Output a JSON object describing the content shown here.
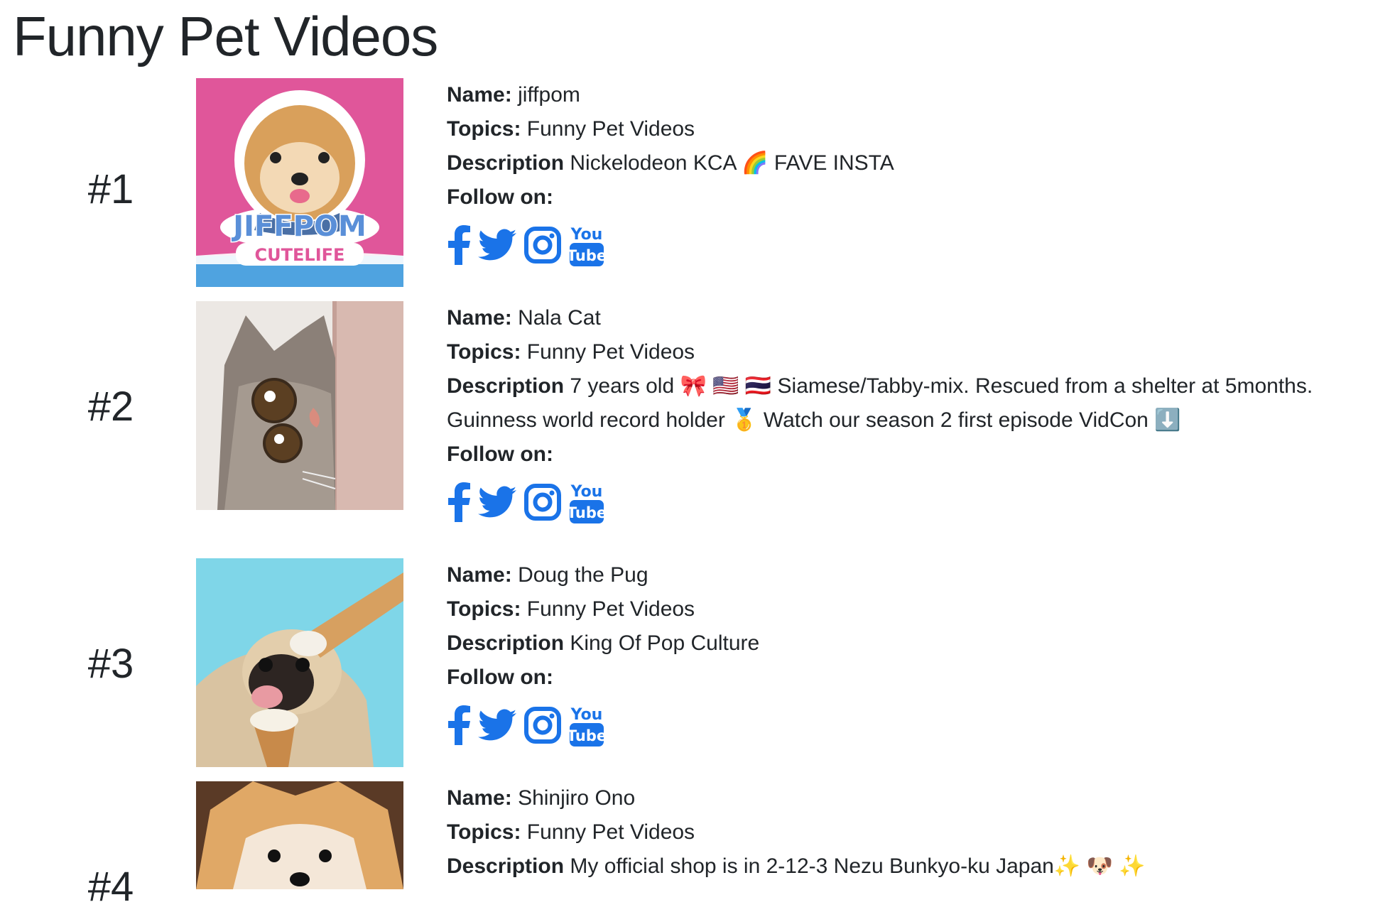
{
  "title": "Funny Pet Videos",
  "labels": {
    "name": "Name",
    "topics": "Topics",
    "description": "Description",
    "follow": "Follow on:",
    "colon": ":"
  },
  "icons": {
    "facebook": "facebook-icon",
    "twitter": "twitter-icon",
    "instagram": "instagram-icon",
    "youtube": "youtube-icon",
    "youtube_you": "You",
    "youtube_tube": "Tube",
    "color": "#1a73e8"
  },
  "entries": [
    {
      "rank": "#1",
      "name": "jiffpom",
      "topics": "Funny Pet Videos",
      "description": "Nickelodeon KCA 🌈  FAVE INSTA",
      "description2": "",
      "image_text_1": "JIFFPOM",
      "image_text_2": "CUTELIFE"
    },
    {
      "rank": "#2",
      "name": "Nala Cat",
      "topics": "Funny Pet Videos",
      "description": "7 years old 🎀  🇺🇸 🇹🇭  Siamese/Tabby-mix. Rescued from a shelter at 5months.",
      "description2": "Guinness world record holder 🥇 Watch our season 2 first episode VidCon ⬇️"
    },
    {
      "rank": "#3",
      "name": "Doug the Pug",
      "topics": "Funny Pet Videos",
      "description": "King Of Pop Culture",
      "description2": ""
    },
    {
      "rank": "#4",
      "name": "Shinjiro Ono",
      "topics": "Funny Pet Videos",
      "description": "My official shop is in 2-12-3 Nezu Bunkyo-ku Japan✨ 🐶 ✨",
      "description2": ""
    }
  ]
}
